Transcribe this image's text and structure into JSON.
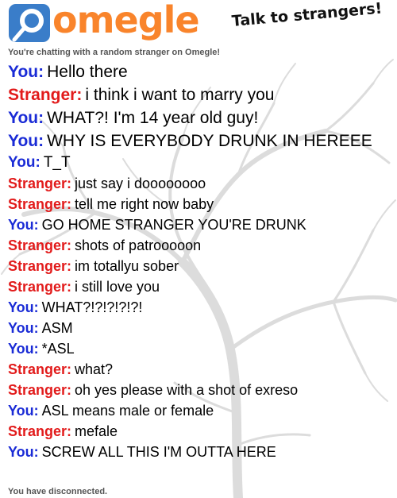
{
  "header": {
    "logo_text": "omegle",
    "tagline": "Talk to strangers!"
  },
  "status": {
    "top": "You're chatting with a random stranger on Omegle!",
    "bottom": "You have disconnected."
  },
  "speakers": {
    "you": "You:",
    "stranger": "Stranger:"
  },
  "colors": {
    "logo": "#f9842b",
    "logo_icon": "#3a7dc9",
    "you": "#1a2bd6",
    "stranger": "#e21b1b"
  },
  "messages": [
    {
      "who": "you",
      "text": "Hello there"
    },
    {
      "who": "stranger",
      "text": "i think i want to marry you"
    },
    {
      "who": "you",
      "text": "WHAT?! I'm 14 year old guy!"
    },
    {
      "who": "you",
      "text": "WHY IS EVERYBODY DRUNK IN HEREEE"
    },
    {
      "who": "you",
      "text": "T_T"
    },
    {
      "who": "stranger",
      "text": "just say i doooooooo"
    },
    {
      "who": "stranger",
      "text": "tell me right now baby"
    },
    {
      "who": "you",
      "text": "GO HOME STRANGER YOU'RE DRUNK"
    },
    {
      "who": "stranger",
      "text": "shots of patrooooon"
    },
    {
      "who": "stranger",
      "text": "im totallyu sober"
    },
    {
      "who": "stranger",
      "text": "i still love you"
    },
    {
      "who": "you",
      "text": "WHAT?!?!?!?!?!"
    },
    {
      "who": "you",
      "text": "ASM"
    },
    {
      "who": "you",
      "text": "*ASL"
    },
    {
      "who": "stranger",
      "text": "what?"
    },
    {
      "who": "stranger",
      "text": "oh yes please with a shot of exreso"
    },
    {
      "who": "you",
      "text": "ASL means male or female"
    },
    {
      "who": "stranger",
      "text": "mefale"
    },
    {
      "who": "you",
      "text": "SCREW ALL THIS I'M OUTTA HERE"
    }
  ]
}
